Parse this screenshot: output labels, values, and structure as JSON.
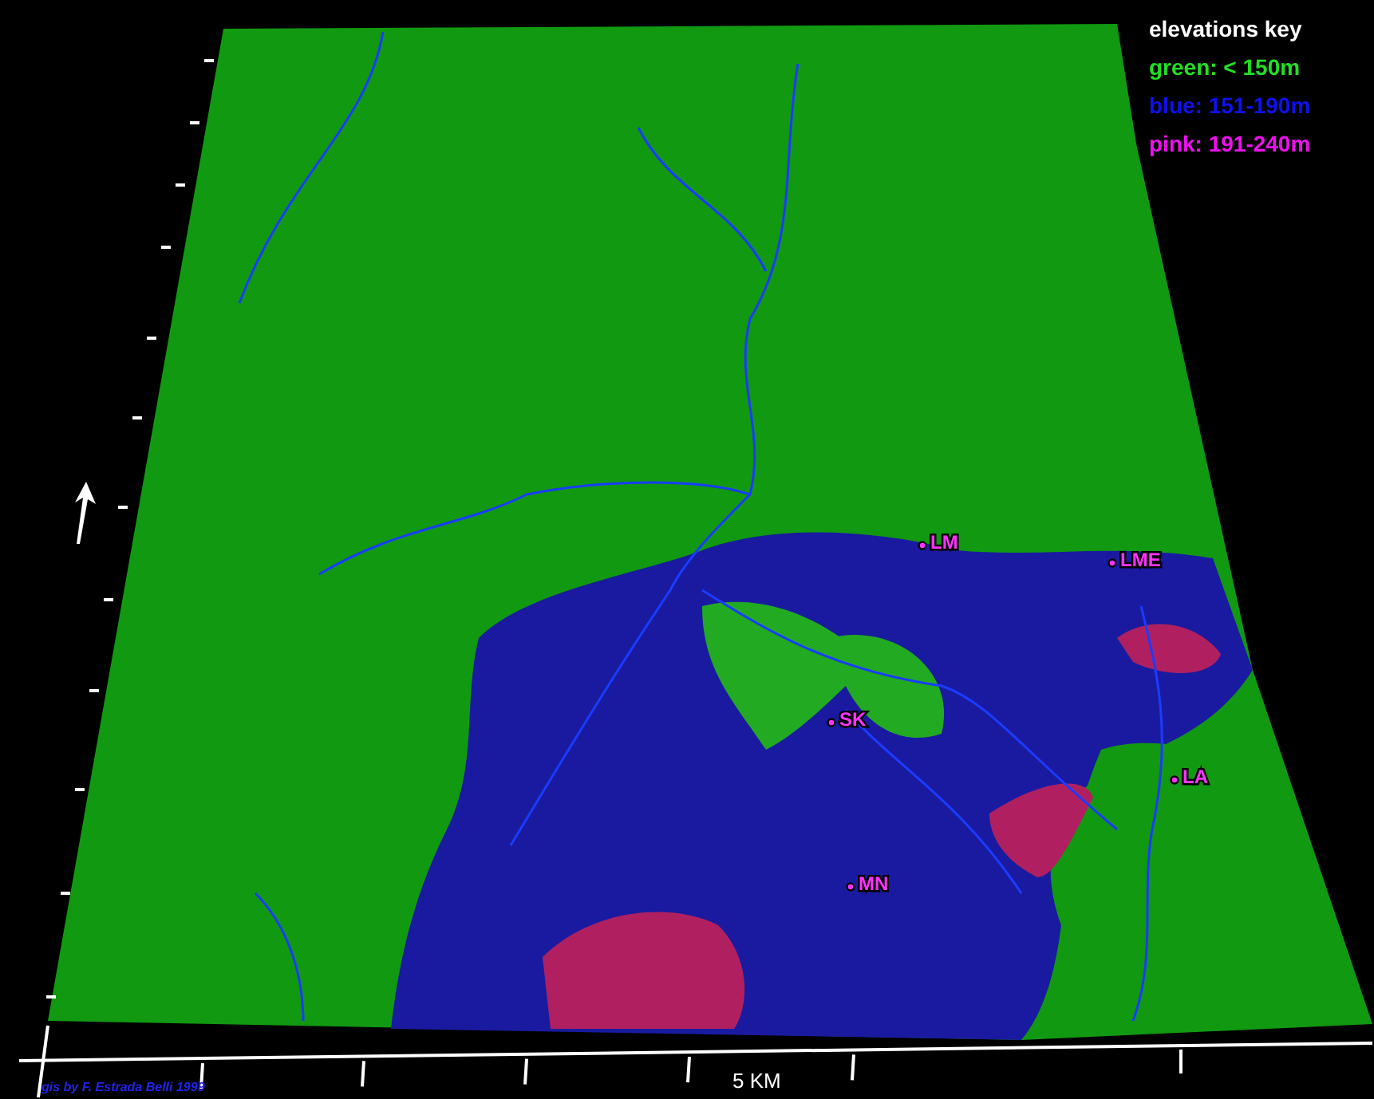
{
  "legend": {
    "title": "elevations key",
    "entries": [
      {
        "label": "green: < 150m",
        "color": "#22e022"
      },
      {
        "label": "blue: 151-190m",
        "color": "#1010ee"
      },
      {
        "label": "pink: 191-240m",
        "color": "#ee10ee"
      }
    ]
  },
  "sites": [
    {
      "label": "LM"
    },
    {
      "label": "LME"
    },
    {
      "label": "SK"
    },
    {
      "label": "LA"
    },
    {
      "label": "MN"
    }
  ],
  "scale_label": "5 KM",
  "credit": "gis by F. Estrada Belli 1999"
}
